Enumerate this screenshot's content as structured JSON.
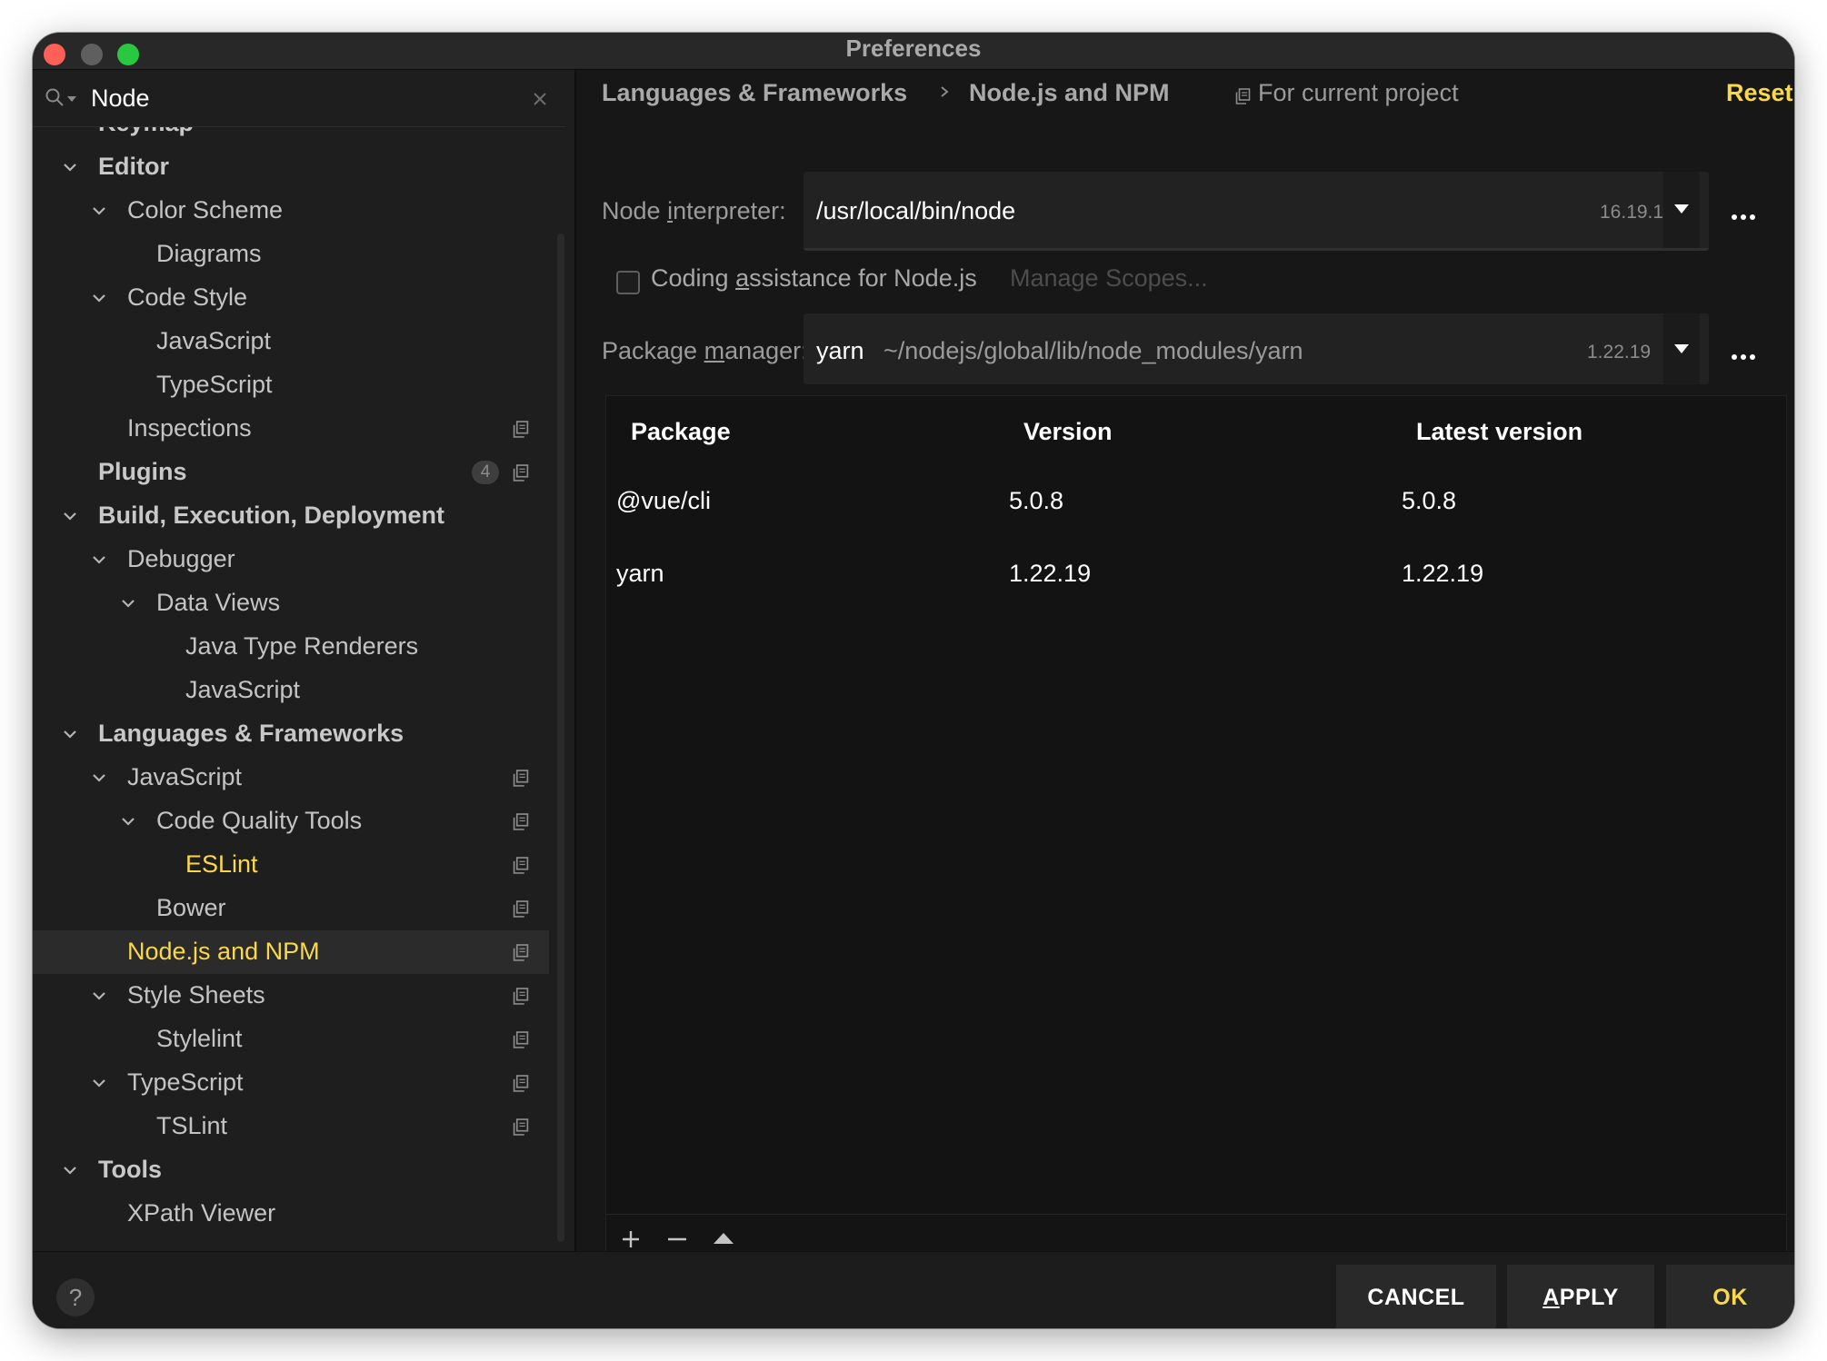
{
  "window": {
    "title": "Preferences"
  },
  "search": {
    "value": "Node"
  },
  "tree": [
    {
      "label": "Keymap",
      "bold": true
    },
    {
      "label": "Editor",
      "bold": true,
      "expanded": true
    },
    {
      "label": "Color Scheme",
      "expanded": true
    },
    {
      "label": "Diagrams"
    },
    {
      "label": "Code Style",
      "expanded": true
    },
    {
      "label": "JavaScript"
    },
    {
      "label": "TypeScript"
    },
    {
      "label": "Inspections",
      "project": true
    },
    {
      "label": "Plugins",
      "bold": true,
      "badge": "4",
      "project": true
    },
    {
      "label": "Build, Execution, Deployment",
      "bold": true,
      "expanded": true
    },
    {
      "label": "Debugger",
      "expanded": true
    },
    {
      "label": "Data Views",
      "expanded": true
    },
    {
      "label": "Java Type Renderers"
    },
    {
      "label": "JavaScript"
    },
    {
      "label": "Languages & Frameworks",
      "bold": true,
      "expanded": true
    },
    {
      "label": "JavaScript",
      "expanded": true,
      "project": true
    },
    {
      "label": "Code Quality Tools",
      "expanded": true,
      "project": true
    },
    {
      "label": "ESLint",
      "highlight": true,
      "project": true
    },
    {
      "label": "Bower",
      "project": true
    },
    {
      "label": "Node.js and NPM",
      "highlight": true,
      "selected": true,
      "project": true
    },
    {
      "label": "Style Sheets",
      "expanded": true,
      "project": true
    },
    {
      "label": "Stylelint",
      "project": true
    },
    {
      "label": "TypeScript",
      "expanded": true,
      "project": true
    },
    {
      "label": "TSLint",
      "project": true
    },
    {
      "label": "Tools",
      "bold": true,
      "expanded": true
    },
    {
      "label": "XPath Viewer"
    }
  ],
  "breadcrumb": {
    "section": "Languages & Frameworks",
    "page": "Node.js and NPM",
    "scope": "For current project",
    "reset": "Reset"
  },
  "interpreter": {
    "label_before": "Node ",
    "label_mnemonic": "i",
    "label_after": "nterpreter:",
    "value": "/usr/local/bin/node",
    "version": "16.19.1"
  },
  "coding_assistance": {
    "label_before": "Coding ",
    "label_mnemonic": "a",
    "label_after": "ssistance for Node.js",
    "checked": false,
    "manage_scopes": "Manage Scopes..."
  },
  "package_manager": {
    "label_before": "Package ",
    "label_mnemonic": "m",
    "label_after": "anager:",
    "value": "yarn",
    "path": "~/nodejs/global/lib/node_modules/yarn",
    "version": "1.22.19"
  },
  "packages": {
    "columns": [
      "Package",
      "Version",
      "Latest version"
    ],
    "rows": [
      [
        "@vue/cli",
        "5.0.8",
        "5.0.8"
      ],
      [
        "yarn",
        "1.22.19",
        "1.22.19"
      ]
    ]
  },
  "footer": {
    "help": "?",
    "cancel": "CANCEL",
    "apply_mnemonic": "A",
    "apply_rest": "PPLY",
    "ok": "OK"
  },
  "colors": {
    "accent": "#f9d94a",
    "window_bg": "#171717",
    "sidebar_bg": "#1e1e1e"
  },
  "icons": {
    "search": "search-icon",
    "clear": "close-icon",
    "expand": "chevron-down-icon",
    "project_scope": "copy-icon",
    "dropdown": "triangle-down-icon",
    "more": "ellipsis-icon",
    "add": "plus-icon",
    "remove": "minus-icon",
    "upgrade": "triangle-up-icon"
  }
}
